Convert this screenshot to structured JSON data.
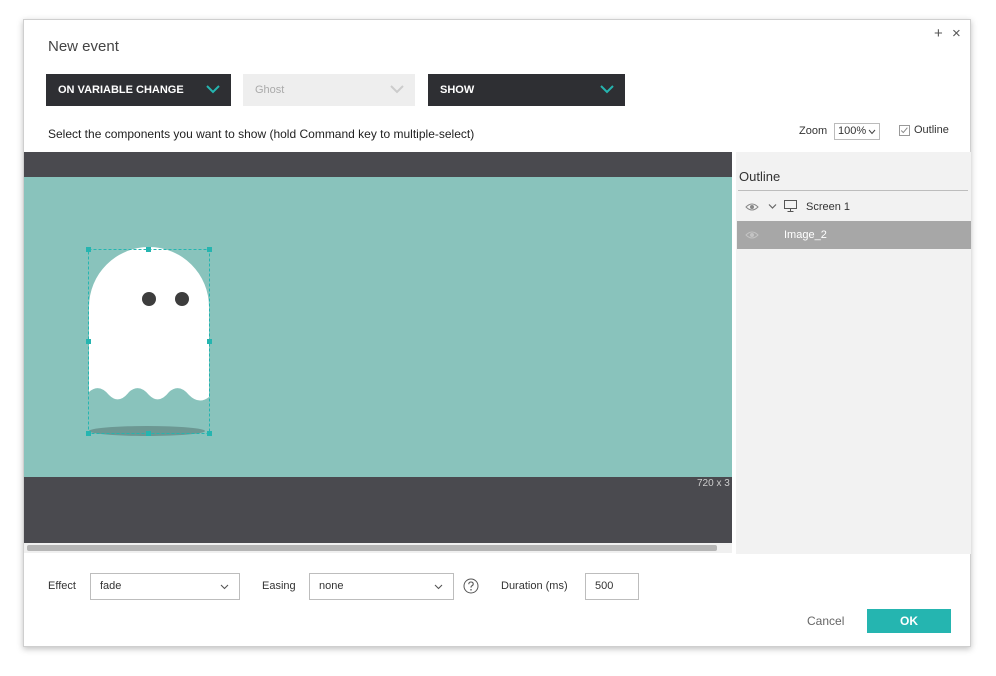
{
  "dialog": {
    "title": "New event",
    "plus": "+",
    "close": "×"
  },
  "trigger": {
    "selected": "ON VARIABLE CHANGE"
  },
  "variable": {
    "selected": "Ghost"
  },
  "action": {
    "selected": "SHOW"
  },
  "instruction": "Select the components you want to show (hold Command key to multiple-select)",
  "zoom": {
    "label": "Zoom",
    "value": "100%"
  },
  "outline_toggle": {
    "label": "Outline",
    "checked": true
  },
  "canvas": {
    "size_text": "720 x 3"
  },
  "outline": {
    "title": "Outline",
    "items": [
      {
        "label": "Screen 1"
      },
      {
        "label": "Image_2"
      }
    ]
  },
  "effect": {
    "label": "Effect",
    "value": "fade"
  },
  "easing": {
    "label": "Easing",
    "value": "none"
  },
  "duration": {
    "label": "Duration (ms)",
    "value": "500"
  },
  "buttons": {
    "cancel": "Cancel",
    "ok": "OK"
  },
  "colors": {
    "accent": "#25b5b0",
    "dark_select": "#2e2f33",
    "screen_bg": "#89c3bc"
  },
  "icons": [
    "chevron-down-icon",
    "eye-icon",
    "monitor-icon",
    "help-icon",
    "check-icon",
    "ghost-image"
  ]
}
